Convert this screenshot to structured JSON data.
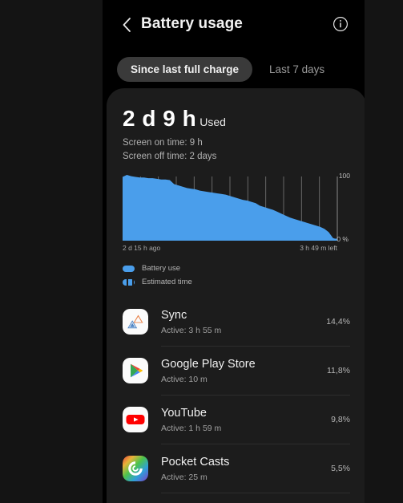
{
  "header": {
    "title": "Battery usage",
    "back_icon": "chevron-left-icon",
    "info_icon": "info-circle-icon"
  },
  "tabs": [
    {
      "label": "Since last full charge",
      "selected": true
    },
    {
      "label": "Last 7 days",
      "selected": false
    }
  ],
  "summary": {
    "usage_value": "2 d 9 h",
    "usage_suffix": "Used",
    "screen_on": "Screen on time: 9 h",
    "screen_off": "Screen off time: 2 days"
  },
  "chart_data": {
    "type": "area",
    "title": "",
    "xlabel": "",
    "ylabel": "",
    "ylim": [
      0,
      100
    ],
    "y_axis_top_label": "100",
    "y_axis_bottom_label": "0 %",
    "x_start_label": "2 d 15 h ago",
    "x_end_label": "3 h 49 m left",
    "grid": true,
    "gridline_count": 11,
    "area_color": "#4a9eeb",
    "legend_position": "below",
    "legend": [
      "Battery use",
      "Estimated time"
    ],
    "x": [
      0,
      2,
      4,
      6,
      8,
      10,
      12,
      14,
      16,
      18,
      20,
      22,
      24,
      26,
      28,
      30,
      32,
      34,
      36,
      38,
      40,
      42,
      44,
      46,
      48,
      50,
      52,
      54,
      56,
      58,
      60,
      62,
      64,
      66,
      68,
      70,
      72,
      74,
      76,
      78,
      80,
      82,
      84,
      86,
      88,
      90,
      92,
      94,
      96,
      98,
      100
    ],
    "values": [
      97,
      100,
      98,
      97,
      96,
      96,
      95,
      95,
      94,
      93,
      93,
      92,
      86,
      84,
      82,
      80,
      79,
      78,
      76,
      75,
      74,
      73,
      72,
      71,
      70,
      68,
      66,
      64,
      62,
      61,
      59,
      57,
      53,
      51,
      49,
      47,
      44,
      41,
      38,
      35,
      33,
      31,
      29,
      27,
      25,
      23,
      21,
      18,
      13,
      4,
      2
    ],
    "series": [
      {
        "name": "Battery use",
        "style": "solid"
      },
      {
        "name": "Estimated time",
        "style": "dashed"
      }
    ]
  },
  "legend": [
    {
      "label": "Battery use",
      "style": "solid"
    },
    {
      "label": "Estimated time",
      "style": "dashed"
    }
  ],
  "apps": [
    {
      "name": "Sync",
      "active": "Active: 3 h 55 m",
      "percent": "14,4%",
      "icon": "sync-app-icon"
    },
    {
      "name": "Google Play Store",
      "active": "Active: 10 m",
      "percent": "11,8%",
      "icon": "google-play-store-icon"
    },
    {
      "name": "YouTube",
      "active": "Active: 1 h 59 m",
      "percent": "9,8%",
      "icon": "youtube-icon"
    },
    {
      "name": "Pocket Casts",
      "active": "Active: 25 m",
      "percent": "5,5%",
      "icon": "pocket-casts-icon"
    }
  ],
  "colors": {
    "page_background": "#141414",
    "screen_background": "#000000",
    "card_background": "#1c1c1c",
    "accent_blue": "#4a9eeb",
    "tab_selected": "#3a3a3a"
  }
}
